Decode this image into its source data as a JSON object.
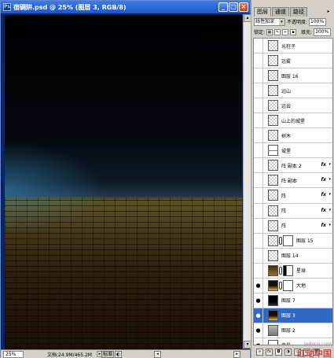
{
  "document": {
    "title": "宿碉阱.psd @ 25% (图层 3, RGB/8)",
    "ps_icon_label": "Ps",
    "window_buttons": {
      "minimize": "_",
      "maximize": "□",
      "close": "×"
    },
    "status": {
      "zoom": "25%",
      "doc_info": "文档:24.9M/465.2M",
      "menu_arrow": "▸"
    },
    "mode_buttons": [
      "标准",
      "◐"
    ],
    "scroll": {
      "up": "▴",
      "down": "▾",
      "left": "◂",
      "right": "▸"
    }
  },
  "panel": {
    "tabs": [
      "图层",
      "通道",
      "路径"
    ],
    "active_tab_index": 0,
    "menu_icon": "▸",
    "blend_mode": "线性加深",
    "opacity_label": "不透明度:",
    "opacity_value": "100%",
    "lock_label": "锁定:",
    "fill_label": "填充:",
    "fill_value": "100%",
    "layers": [
      {
        "name": "光柱子",
        "thumb": "checker",
        "visible": false,
        "fx": false
      },
      {
        "name": "远雾",
        "thumb": "checker",
        "visible": false,
        "fx": false
      },
      {
        "name": "图层 16",
        "thumb": "checker",
        "visible": false,
        "fx": false
      },
      {
        "name": "远山",
        "thumb": "checker",
        "visible": false,
        "fx": false
      },
      {
        "name": "远云",
        "thumb": "checker",
        "visible": false,
        "fx": false
      },
      {
        "name": "山上的城堡",
        "thumb": "checker",
        "visible": false,
        "fx": false
      },
      {
        "name": "树木",
        "thumb": "checker",
        "visible": false,
        "fx": false
      },
      {
        "name": "城堡",
        "thumb": "line",
        "visible": false,
        "fx": false
      },
      {
        "name": "阵 副本 2",
        "thumb": "checker",
        "visible": false,
        "fx": true
      },
      {
        "name": "阵 副本",
        "thumb": "checker",
        "visible": false,
        "fx": true
      },
      {
        "name": "阵",
        "thumb": "checker",
        "visible": false,
        "fx": true
      },
      {
        "name": "阵",
        "thumb": "checker",
        "visible": false,
        "fx": true
      },
      {
        "name": "阵",
        "thumb": "checker",
        "visible": false,
        "fx": true
      },
      {
        "name": "图层 15",
        "thumb": "checker",
        "visible": false,
        "fx": false,
        "mask": "w"
      },
      {
        "name": "图层 14",
        "thumb": "checker",
        "visible": false,
        "fx": false
      },
      {
        "name": "星球",
        "thumb": "brown",
        "visible": false,
        "fx": false,
        "mask": "half"
      },
      {
        "name": "大地",
        "thumb": "ground",
        "visible": true,
        "fx": false,
        "mask": "w"
      },
      {
        "name": "图层 7",
        "thumb": "dark",
        "visible": true,
        "fx": false
      },
      {
        "name": "图层 3",
        "thumb": "ground",
        "visible": true,
        "fx": false,
        "selected": true
      },
      {
        "name": "图层 2",
        "thumb": "gray",
        "visible": true,
        "fx": false
      },
      {
        "name": "背景",
        "thumb": "white",
        "visible": true,
        "fx": false
      }
    ],
    "fx_label": "fx",
    "fx_arrow": "▾",
    "eye_glyph": "●",
    "bottom_icons": [
      "∞",
      "fx",
      "◘",
      "◑",
      "▭",
      "▤",
      "🗑"
    ],
    "watermark_url": "redocn.com",
    "watermark_text": "红动中国"
  }
}
